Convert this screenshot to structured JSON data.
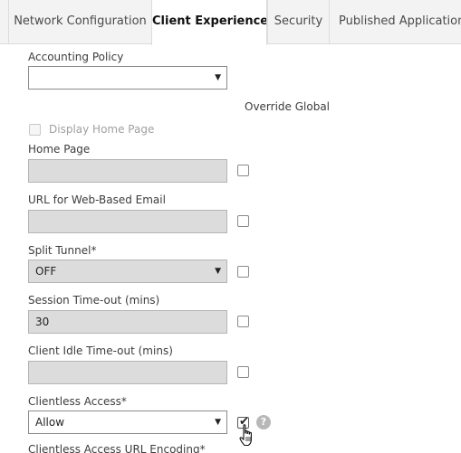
{
  "tabs": [
    {
      "label": "Network Configuration"
    },
    {
      "label": "Client Experience"
    },
    {
      "label": "Security"
    },
    {
      "label": "Published Applications"
    }
  ],
  "accounting_policy": {
    "label": "Accounting Policy",
    "value": ""
  },
  "override_global": {
    "label": "Override Global"
  },
  "display_home_page": {
    "label": "Display Home Page",
    "checked": false,
    "disabled": true
  },
  "home_page": {
    "label": "Home Page",
    "value": "",
    "override_checked": false
  },
  "web_email": {
    "label": "URL for Web-Based Email",
    "value": "",
    "override_checked": false
  },
  "split_tunnel": {
    "label": "Split Tunnel*",
    "value": "OFF",
    "override_checked": false
  },
  "session_timeout": {
    "label": "Session Time-out (mins)",
    "value": "30",
    "override_checked": false
  },
  "client_idle_timeout": {
    "label": "Client Idle Time-out (mins)",
    "value": "",
    "override_checked": false
  },
  "clientless_access": {
    "label": "Clientless Access*",
    "value": "Allow",
    "override_checked": true
  },
  "clientless_url_encoding": {
    "label": "Clientless Access URL Encoding*"
  },
  "icons": {
    "dropdown": "chevron-down-icon",
    "help": "help-icon",
    "cursor": "hand-cursor-icon"
  },
  "colors": {
    "tab_bar": "#f3f3f3",
    "disabled_field": "#dcdcdc",
    "help_icon": "#b8b8b8"
  }
}
